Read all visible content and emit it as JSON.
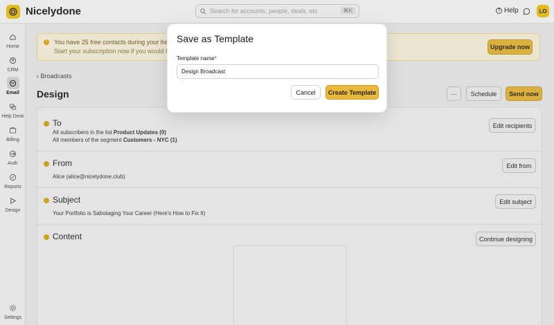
{
  "app": {
    "title": "Nicelydone",
    "avatar_initials": "LO"
  },
  "header": {
    "search_placeholder": "Search for accounts, people, deals, etc",
    "search_shortcut": "⌘K",
    "help_label": "Help"
  },
  "sidebar": {
    "items": [
      {
        "label": "Home",
        "icon": "home-icon"
      },
      {
        "label": "CRM",
        "icon": "crm-icon"
      },
      {
        "label": "Email",
        "icon": "email-icon",
        "active": true
      },
      {
        "label": "Help Desk",
        "icon": "helpdesk-icon"
      },
      {
        "label": "Billing",
        "icon": "billing-icon"
      },
      {
        "label": "Auth",
        "icon": "auth-icon"
      },
      {
        "label": "Reports",
        "icon": "reports-icon"
      },
      {
        "label": "Design",
        "icon": "design-icon"
      }
    ],
    "settings_label": "Settings"
  },
  "banner": {
    "line1": "You have 25 free contacts during your free trial",
    "line2": "Start your subscription now if you would like to i",
    "upgrade_label": "Upgrade now"
  },
  "breadcrumb": {
    "label": "Broadcasts"
  },
  "page": {
    "title": "Design"
  },
  "actions": {
    "more_label": "···",
    "schedule_label": "Schedule",
    "send_label": "Send now"
  },
  "sections": {
    "to": {
      "title": "To",
      "line1_prefix": "All subscribers in the list ",
      "line1_bold": "Product Updates (0)",
      "line2_prefix": "All members of the segment ",
      "line2_bold": "Customers - NYC (1)",
      "button": "Edit recipients"
    },
    "from": {
      "title": "From",
      "value": "Alice (alice@nicelydone.club)",
      "button": "Edit from"
    },
    "subject": {
      "title": "Subject",
      "value": "Your Portfolio is Sabotaging Your Career (Here's How to Fix It)",
      "button": "Edit subject"
    },
    "content": {
      "title": "Content",
      "button": "Continue designing"
    }
  },
  "modal": {
    "title": "Save as Template",
    "field_label": "Template name",
    "required_mark": "*",
    "field_value": "Design Broadcast",
    "cancel_label": "Cancel",
    "create_label": "Create Template"
  },
  "colors": {
    "accent": "#e8b93a",
    "brand": "#f1c40f"
  }
}
